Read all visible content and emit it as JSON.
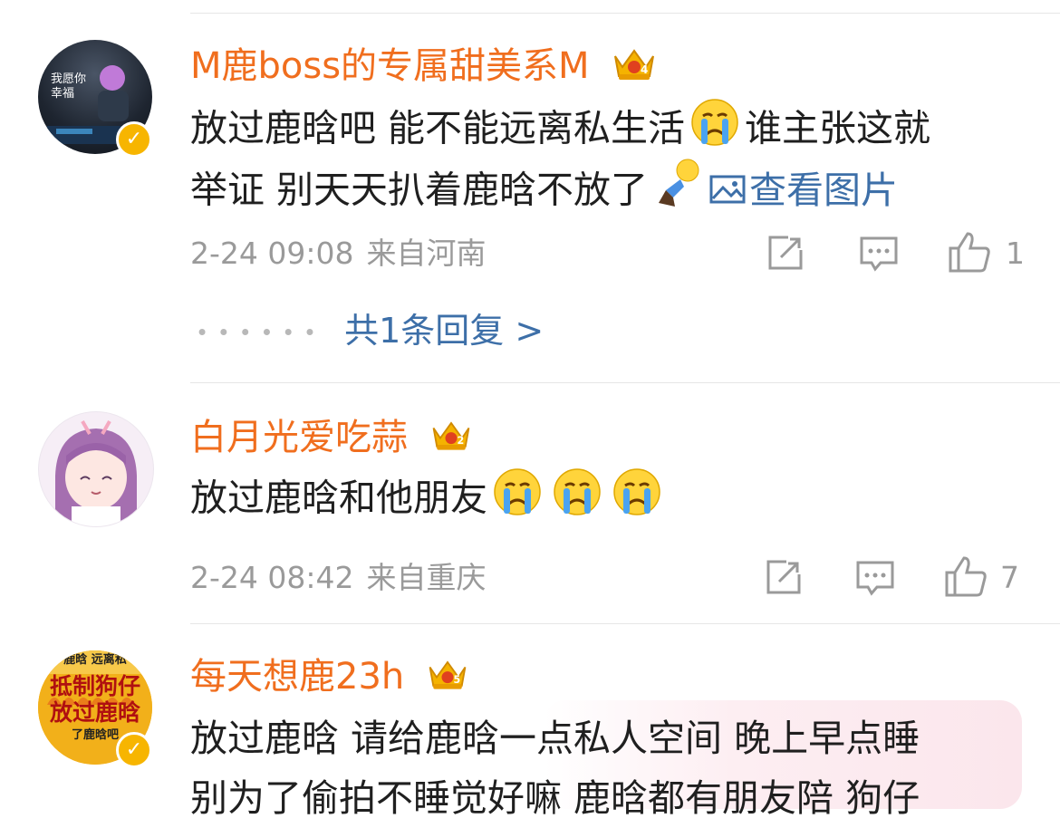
{
  "comments": [
    {
      "username": "M鹿boss的专属甜美系M",
      "crown_level": "4",
      "verified": true,
      "avatar_text": [
        "我愿你",
        "幸福"
      ],
      "line1_a": "放过鹿晗吧 能不能远离私生活",
      "line1_b": "谁主张这就",
      "line2": "举证 别天天扒着鹿晗不放了",
      "link_label": "查看图片",
      "time": "2-24 09:08",
      "location": "来自河南",
      "likes": "1",
      "replies": "共1条回复 >"
    },
    {
      "username": "白月光爱吃蒜",
      "crown_level": "2",
      "verified": false,
      "line1": "放过鹿晗和他朋友",
      "time": "2-24 08:42",
      "location": "来自重庆",
      "likes": "7"
    },
    {
      "username": "每天想鹿23h",
      "crown_level": "5",
      "verified": true,
      "avatar_text": [
        "鹿晗 远离私",
        "抵制狗仔",
        "放过鹿晗",
        "了鹿晗吧"
      ],
      "line1": "放过鹿晗 请给鹿晗一点私人空间 晚上早点睡",
      "line2": "别为了偷拍不睡觉好嘛 鹿晗都有朋友陪 狗仔"
    }
  ],
  "icons": {
    "repost": "repost-icon",
    "comment": "comment-icon",
    "like": "thumbs-up-icon",
    "image": "image-icon",
    "crown": "crown-icon",
    "verified": "verified-badge-icon",
    "crying": "crying-emoji-icon",
    "kneel": "kneeling-emoji-icon"
  },
  "colors": {
    "username": "#f06e1e",
    "link": "#3d6fa8",
    "meta": "#9a9a9a",
    "verified": "#f7b500"
  }
}
